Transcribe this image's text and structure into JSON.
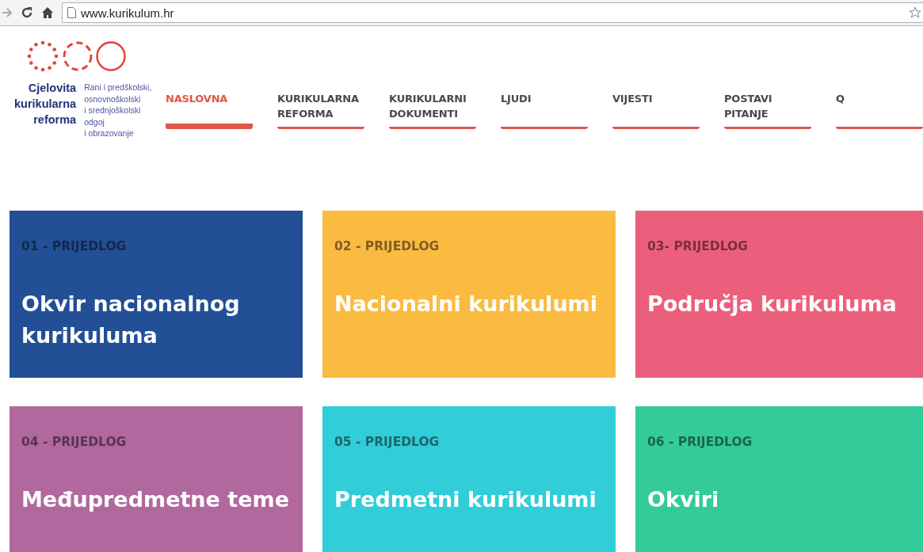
{
  "browser": {
    "url": "www.kurikulum.hr"
  },
  "logo": {
    "title": [
      "Cjelovita",
      "kurikularna",
      "reforma"
    ],
    "subtitle": [
      "Rani i predškolski,",
      "osnovnoškolski",
      "i srednjoškolski odgoj",
      "i obrazovanje"
    ]
  },
  "nav": [
    {
      "label": "NASLOVNA",
      "selected": true
    },
    {
      "label": "KURIKULARNA REFORMA",
      "selected": false
    },
    {
      "label": "KURIKULARNI DOKUMENTI",
      "selected": false
    },
    {
      "label": "LJUDI",
      "selected": false
    },
    {
      "label": "VIJESTI",
      "selected": false
    },
    {
      "label": "POSTAVI PITANJE",
      "selected": false
    },
    {
      "label": "Q",
      "selected": false
    }
  ],
  "cards": [
    {
      "label": "01 - PRIJEDLOG",
      "title": "Okvir nacionalnog kurikuluma",
      "color": "#224f96"
    },
    {
      "label": "02 - PRIJEDLOG",
      "title": "Nacionalni kurikulumi",
      "color": "#fbbb41"
    },
    {
      "label": "03- PRIJEDLOG",
      "title": "Područja kurikuluma",
      "color": "#ec5f7c"
    },
    {
      "label": "04 - PRIJEDLOG",
      "title": "Međupredmetne teme",
      "color": "#b1689f"
    },
    {
      "label": "05 - PRIJEDLOG",
      "title": "Predmetni kurikulumi",
      "color": "#31cdd9"
    },
    {
      "label": "06 - PRIJEDLOG",
      "title": "Okviri",
      "color": "#33cb99"
    }
  ]
}
